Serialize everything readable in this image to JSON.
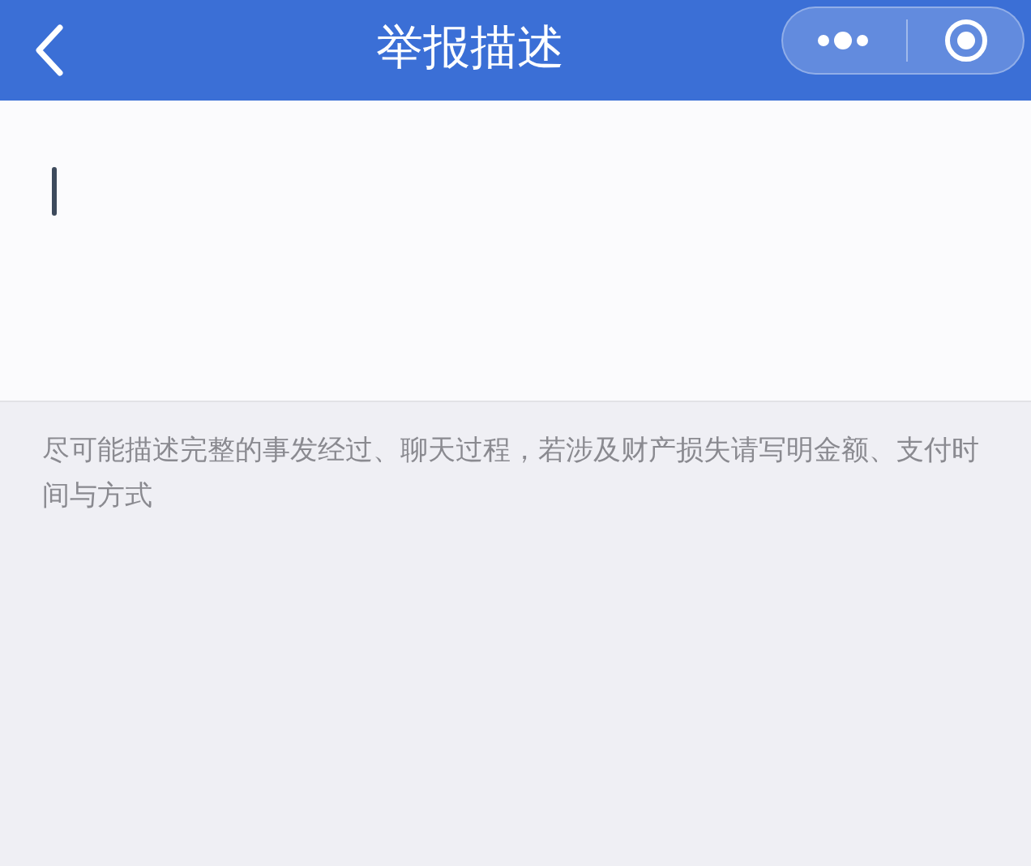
{
  "nav_bar": {
    "title": "举报描述"
  },
  "description_field": {
    "focused": true
  },
  "hint": "尽可能描述完整的事发经过、聊天过程，若涉及财产损失请写明金额、支付时间与方式"
}
